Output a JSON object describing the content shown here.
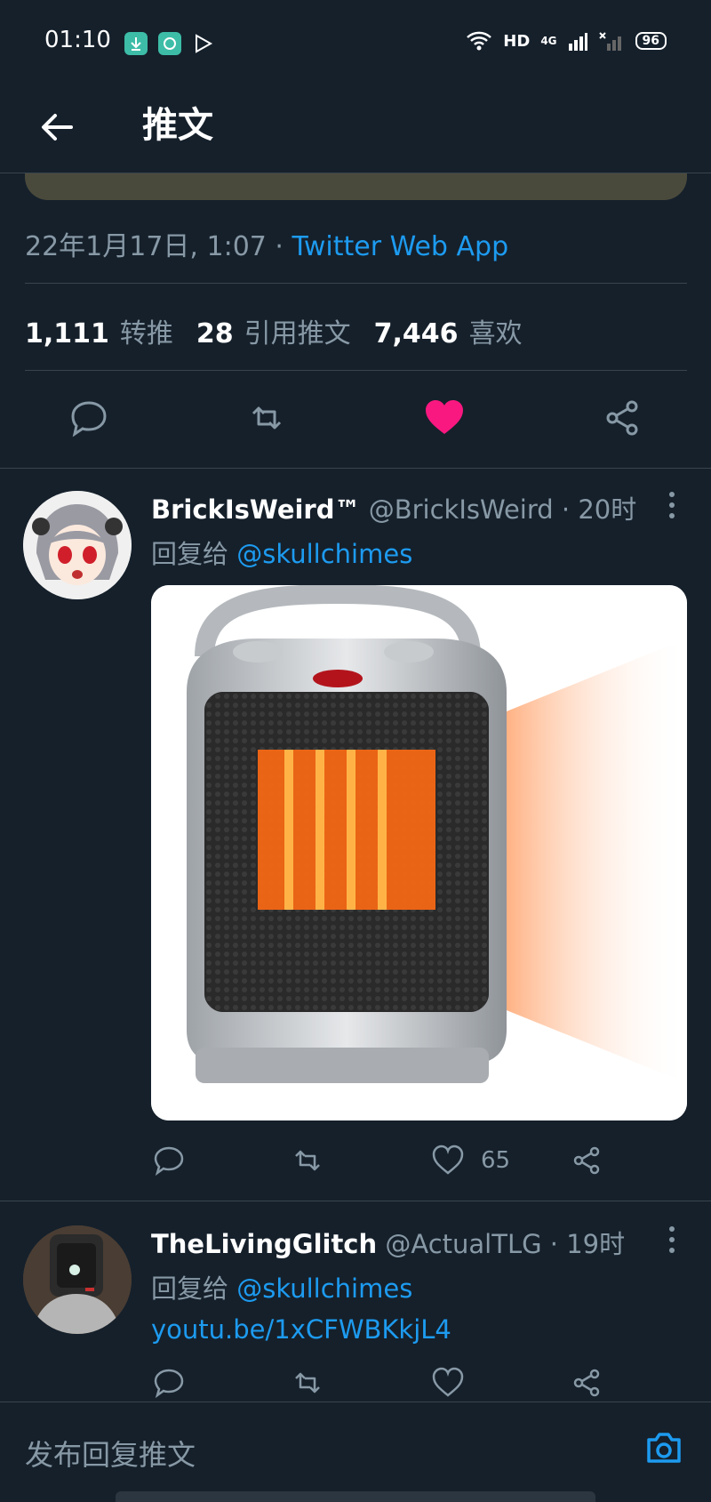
{
  "status_bar": {
    "time": "01:10",
    "network_label": "HD",
    "signal_label": "4G",
    "battery": "96"
  },
  "header": {
    "title": "推文"
  },
  "tweet_meta": {
    "date": "22年1月17日, 1:07",
    "separator": " · ",
    "source": "Twitter Web App"
  },
  "stats": {
    "retweets": "1,111",
    "retweets_label": "转推",
    "quotes": "28",
    "quotes_label": "引用推文",
    "likes": "7,446",
    "likes_label": "喜欢"
  },
  "colors": {
    "background": "#15202b",
    "accent": "#1d9bf0",
    "like": "#f91880",
    "secondary_text": "#8899a6"
  },
  "replies": [
    {
      "name": "BrickIsWeird™",
      "handle": "@BrickIsWeird",
      "time": " · 20时",
      "reply_prefix": "回复给 ",
      "mention": "@skullchimes",
      "like_count": "65"
    },
    {
      "name": "TheLivingGlitch",
      "handle": "@ActualTLG",
      "time": " · 19时",
      "reply_prefix": "回复给 ",
      "mention": "@skullchimes",
      "link": "youtu.be/1xCFWBKkjL4"
    }
  ],
  "composer": {
    "placeholder": "发布回复推文"
  }
}
